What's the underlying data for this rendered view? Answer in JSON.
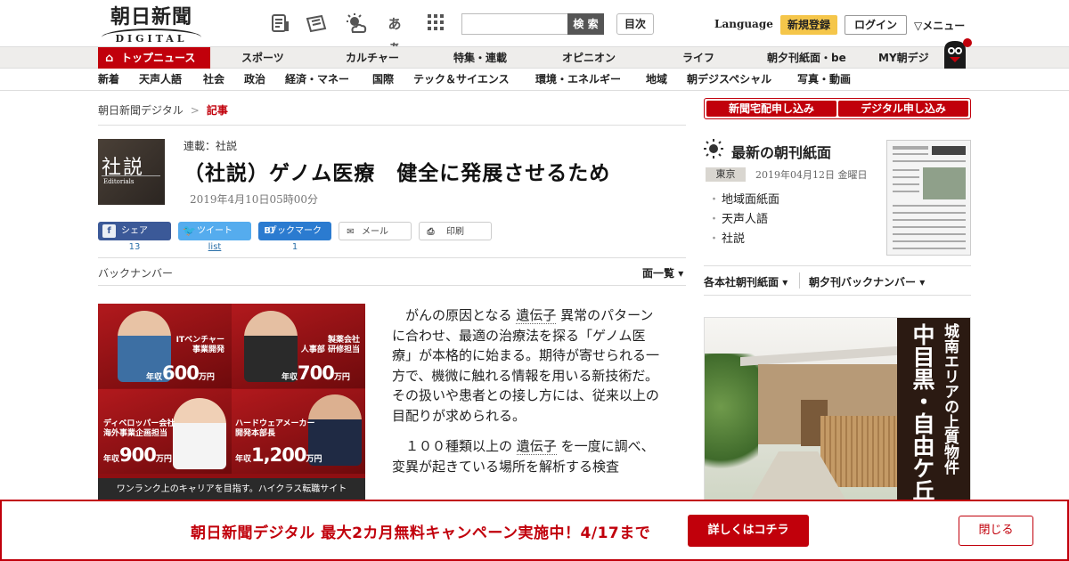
{
  "header": {
    "logo_kanji": "朝日新聞",
    "logo_sub": "DIGITAL",
    "search_placeholder": "",
    "search_label": "検 索",
    "toc_label": "目次",
    "language_label": "Language",
    "register_label": "新規登録",
    "login_label": "ログイン",
    "menu_label": "メニュー",
    "icons": [
      "newspaper-list-icon",
      "newspaper-icon",
      "weather-icon",
      "font-size-icon",
      "grid-apps-icon"
    ],
    "font_icon_text": "あぁ"
  },
  "nav1": {
    "items": [
      "トップニュース",
      "スポーツ",
      "カルチャー",
      "特集・連載",
      "オピニオン",
      "ライフ",
      "朝夕刊紙面・be",
      "MY朝デジ"
    ]
  },
  "nav2": {
    "items": [
      "新着",
      "天声人語",
      "社会",
      "政治",
      "経済・マネー",
      "国際",
      "テック＆サイエンス",
      "環境・エネルギー",
      "地域",
      "朝デジスペシャル",
      "写真・動画"
    ]
  },
  "breadcrumb": {
    "home": "朝日新聞デジタル",
    "sep": ">",
    "current": "記事"
  },
  "article": {
    "thumb_big": "社説",
    "thumb_small": "Editorials",
    "series": "連載：社説",
    "title": "（社説）ゲノム医療　健全に発展させるため",
    "date": "2019年4月10日05時00分",
    "share": {
      "facebook": "シェア",
      "facebook_count": "13",
      "twitter": "ツイート",
      "twitter_count": "list",
      "hatena": "ブックマーク",
      "hatena_icon": "B!",
      "hatena_count": "1",
      "mail": "メール",
      "print": "印刷"
    },
    "backnumber": "バックナンバー",
    "page_list": "面一覧",
    "p1_a": "がんの原因となる",
    "p1_kw": "遺伝子",
    "p1_b": "異常のパターンに合わせ、最適の治療法を探る「ゲノム医療」が本格的に始まる。期待が寄せられる一方で、機微に触れる情報を用いる新技術だ。その扱いや患者との接し方には、従来以上の目配りが求められる。",
    "p2_a": "１００種類以上の",
    "p2_kw": "遺伝子",
    "p2_b": "を一度に調べ、変異が起きている場所を解析する検査"
  },
  "ad_left": {
    "cells": [
      {
        "role1": "ITベンチャー",
        "role2": "事業開発",
        "prefix": "年収",
        "amount": "600",
        "unit": "万円"
      },
      {
        "role1": "製薬会社",
        "role2": "人事部 研修担当",
        "prefix": "年収",
        "amount": "700",
        "unit": "万円"
      },
      {
        "role1": "ディベロッパー会社",
        "role2": "海外事業企画担当",
        "prefix": "年収",
        "amount": "900",
        "unit": "万円"
      },
      {
        "role1": "ハードウェアメーカー",
        "role2": "開発本部長",
        "prefix": "年収",
        "amount": "1,200",
        "unit": "万円"
      }
    ],
    "footer": "ワンランク上のキャリアを目指す。ハイクラス転職サイト"
  },
  "right": {
    "sub_home": "新聞宅配申し込み",
    "sub_digital": "デジタル申し込み",
    "latest_title": "最新の朝刊紙面",
    "region": "東京",
    "paper_date": "2019年04月12日 金曜日",
    "links": [
      "地域面紙面",
      "天声人語",
      "社説"
    ],
    "drop1": "各本社朝刊紙面",
    "drop2": "朝夕刊バックナンバー"
  },
  "ad_right": {
    "line1": "城南エリアの上質物件",
    "line2": "中目黒・自由ケ丘"
  },
  "banner": {
    "text": "朝日新聞デジタル 最大2カ月無料キャンペーン実施中！4/17まで",
    "cta": "詳しくはコチラ",
    "close": "閉じる"
  },
  "colors": {
    "brand_red": "#c1000b",
    "register_yellow": "#f5c64a",
    "facebook": "#3b5998",
    "twitter": "#55acee",
    "hatena": "#2b7bd0"
  }
}
